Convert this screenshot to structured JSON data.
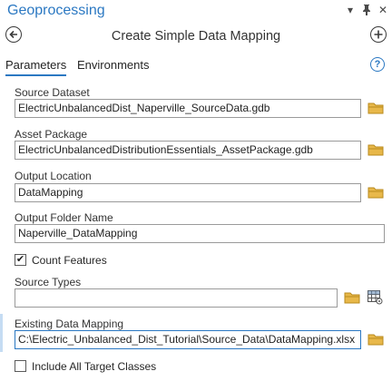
{
  "app": {
    "title": "Geoprocessing",
    "buttons": {
      "menu": "▾",
      "pin": "📌",
      "close": "✕"
    }
  },
  "tool": {
    "title": "Create Simple Data Mapping"
  },
  "tabs": [
    {
      "label": "Parameters"
    },
    {
      "label": "Environments"
    }
  ],
  "help": "?",
  "params": {
    "source_dataset": {
      "label": "Source Dataset",
      "value": "ElectricUnbalancedDist_Naperville_SourceData.gdb"
    },
    "asset_package": {
      "label": "Asset Package",
      "value": "ElectricUnbalancedDistributionEssentials_AssetPackage.gdb"
    },
    "output_location": {
      "label": "Output Location",
      "value": "DataMapping"
    },
    "output_folder_name": {
      "label": "Output Folder Name",
      "value": "Naperville_DataMapping"
    },
    "count_features": {
      "label": "Count Features",
      "checked": "✔"
    },
    "source_types": {
      "label": "Source Types",
      "value": ""
    },
    "existing_data_mapping": {
      "label": "Existing Data Mapping",
      "value": "C:\\Electric_Unbalanced_Dist_Tutorial\\Source_Data\\DataMapping.xlsx"
    },
    "include_all_target_classes": {
      "label": "Include All Target Classes",
      "checked": ""
    }
  },
  "colors": {
    "accent": "#2b78c2",
    "folder": "#e8b84a"
  }
}
